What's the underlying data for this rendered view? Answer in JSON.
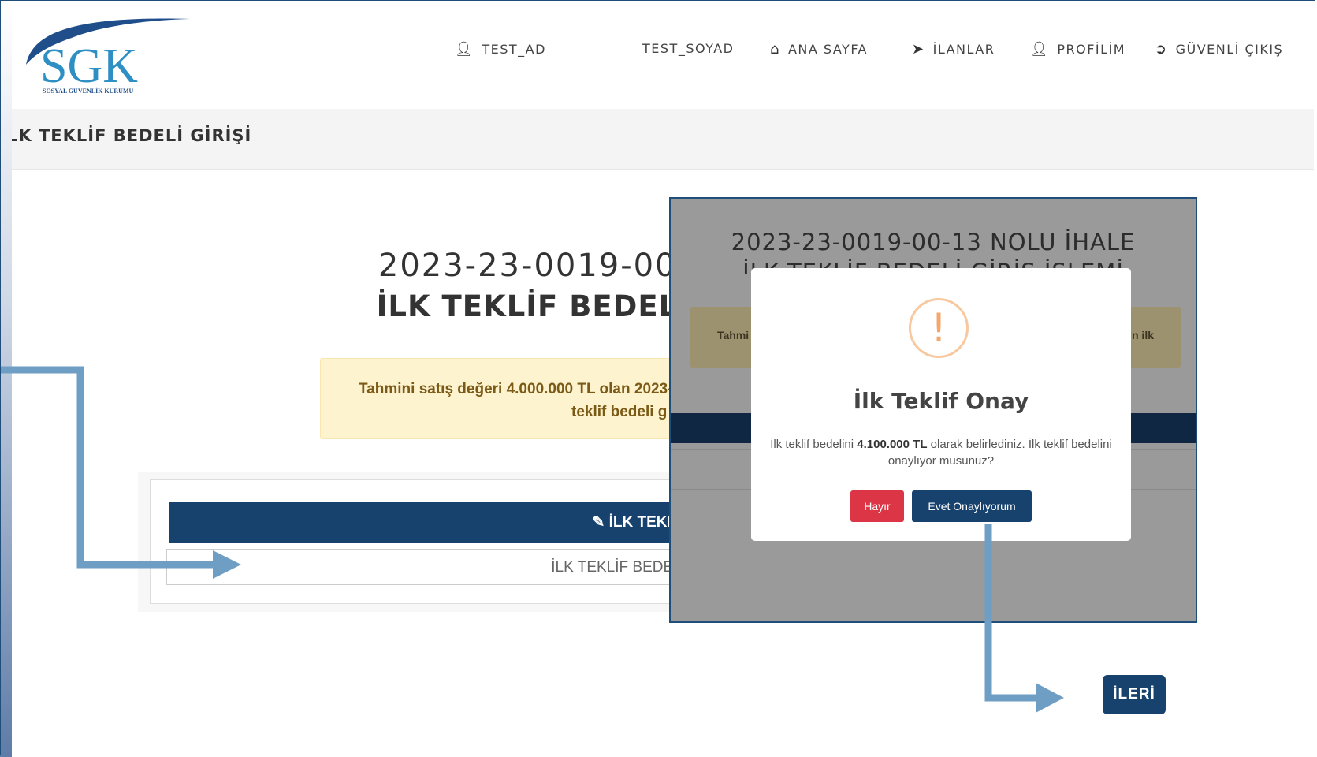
{
  "logo": {
    "letters": "SGK",
    "subtitle": "SOSYAL GÜVENLİK KURUMU"
  },
  "nav": {
    "first_name": "TEST_AD",
    "last_name": "TEST_SOYAD",
    "home": "ANA SAYFA",
    "listings": "İLANLAR",
    "profile": "PROFİLİM",
    "logout": "GÜVENLİ ÇIKIŞ"
  },
  "page": {
    "section_title": "LK TEKLİF BEDELİ GİRİŞİ",
    "title_line1": "2023-23-0019-00-",
    "title_line2": "İLK TEKLİF BEDELİ",
    "alert_line1": "Tahmini satış değeri 4.000.000 TL olan 2023-",
    "alert_line2": "teklif bedeli g",
    "panel_header": "İLK TEKLİF",
    "input_label": "İLK TEKLİF BEDELİ"
  },
  "overlay": {
    "title_line1": "2023-23-0019-00-13 NOLU İHALE",
    "title_line2": "İLK TEKLİF BEDELİ GİRİŞ İŞLEMİ",
    "alert_left": "Tahmi",
    "alert_right": "n ilk"
  },
  "modal": {
    "icon": "!",
    "title": "İlk Teklif Onay",
    "text_before": "İlk teklif bedelini ",
    "amount": "4.100.000 TL",
    "text_after": " olarak belirlediniz. İlk teklif bedelini onaylıyor musunuz?",
    "no_label": "Hayır",
    "yes_label": "Evet Onaylıyorum"
  },
  "next_label": "İLERİ",
  "colors": {
    "primary": "#17426e",
    "danger": "#dc3545",
    "arrow": "#6f9ec4",
    "warning_icon": "#f5a66a"
  }
}
